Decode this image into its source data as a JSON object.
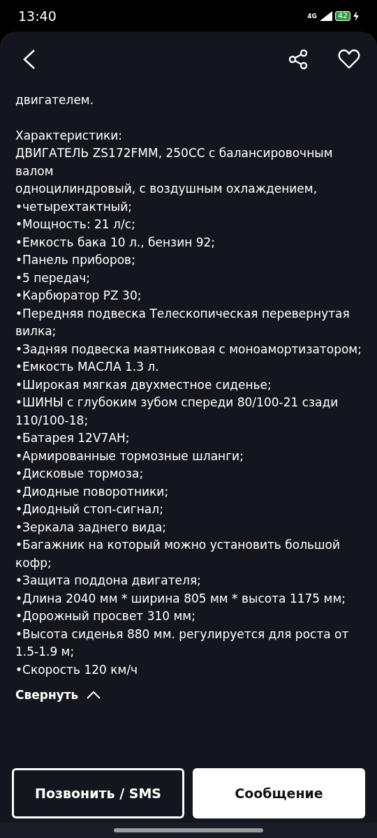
{
  "status_bar": {
    "time": "13:40",
    "network": "4G",
    "battery": "42"
  },
  "description": {
    "paragraphs": [
      [
        "двигателем."
      ],
      [
        "Характеристики:",
        "ДВИГАТЕЛЬ ZS172FMM, 250CC с балансировочным валом",
        "одноцилиндровый, с воздушным охлаждением,",
        "•четырехтактный;",
        "•Мощность: 21 л/с;",
        "•Емкость бака 10 л., бензин 92;",
        "•Панель приборов;",
        "•5 передач;",
        "•Карбюратор PZ 30;",
        "•Передняя подвеска Телескопическая перевернутая вилка;",
        "•Задняя подвеска маятниковая с моноамортизатором;",
        "•Емкость МАСЛА 1.3 л.",
        "•Широкая мягкая двухместное сиденье;",
        "•ШИНЫ с глубоким зубом спереди 80/100-21 сзади 110/100-18;",
        "•Батарея 12V7AH;",
        "•Армированные тормозные шланги;",
        "•Дисковые тормоза;",
        "•Диодные поворотники;",
        "•Диодный стоп-сигнал;",
        "•Зеркала заднего вида;",
        "•Багажник на который можно установить большой кофр;",
        "•Защита поддона двигателя;",
        "•Длина 2040 мм * ширина 805 мм * высота 1175 мм;",
        "•Дорожный просвет 310 мм;",
        "•Высота сиденья 880 мм. регулируется для роста от 1.5-1.9 м;",
        "•Скорость 120 км/ч"
      ]
    ],
    "collapse_label": "Свернуть"
  },
  "actions": [
    {
      "label": "Позвонить / SMS",
      "kind": "outline"
    },
    {
      "label": "Сообщение",
      "kind": "filled"
    }
  ]
}
